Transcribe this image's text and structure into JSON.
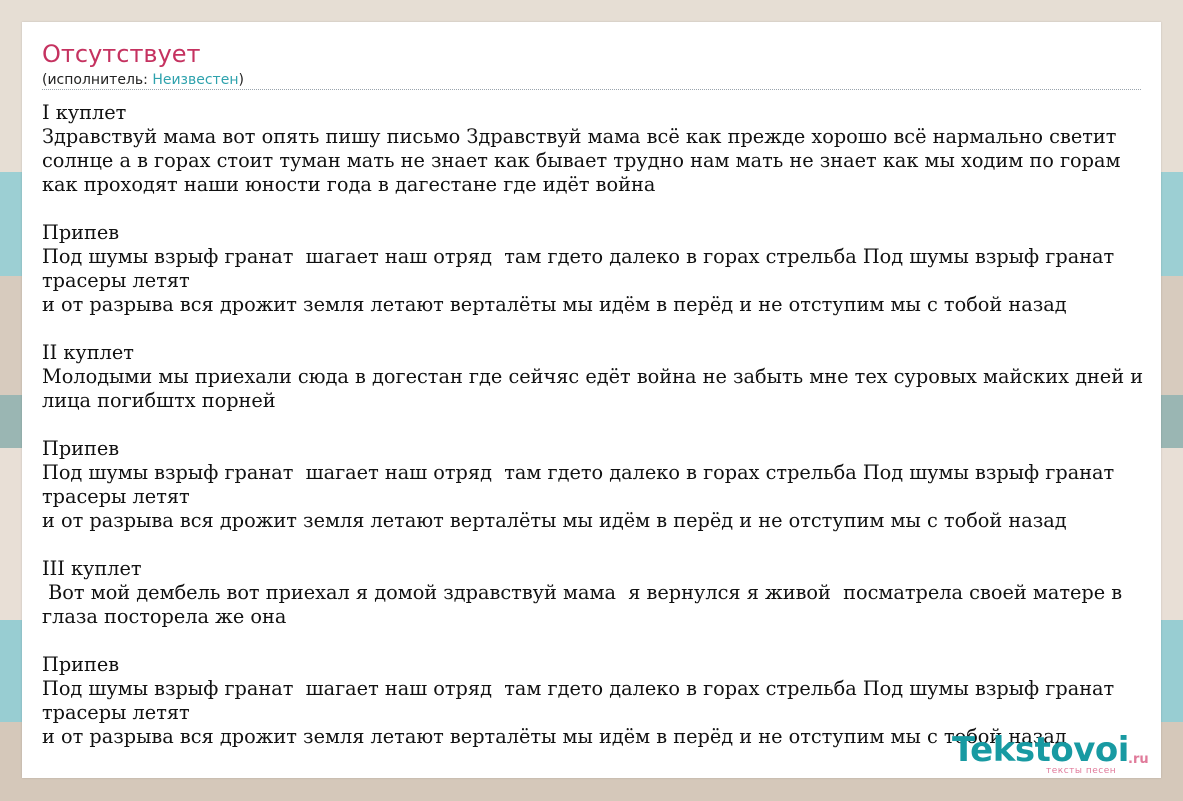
{
  "song": {
    "title": "Отсутствует",
    "artist_prefix": "(исполнитель: ",
    "artist_name": "Неизвестен",
    "artist_suffix": ")"
  },
  "lyrics": [
    "I куплет",
    "Здравствуй мама вот опять пишу письмо Здравствуй мама всё как прежде хорошо всё нармально светит",
    "солнце а в горах стоит туман мать не знает как бывает трудно нам мать не знает как мы ходим по горам",
    "как проходят наши юности года в дагестане где идёт война",
    "",
    "Припев",
    "Под шумы взрыф гранат  шагает наш отряд  там гдето далеко в горах стрельба Под шумы взрыф гранат",
    "трасеры летят",
    "и от разрыва вся дрожит земля летают верталёты мы идём в перёд и не отступим мы с тобой назад",
    "",
    "II куплет",
    "Молодыми мы приехали сюда в догестан где сейчяс едёт война не забыть мне тех суровых майских дней и",
    "лица погибштх порней",
    "",
    "Припев",
    "Под шумы взрыф гранат  шагает наш отряд  там гдето далеко в горах стрельба Под шумы взрыф гранат",
    "трасеры летят",
    "и от разрыва вся дрожит земля летают верталёты мы идём в перёд и не отступим мы с тобой назад",
    "",
    "III куплет",
    " Вот мой дембель вот приехал я домой здравствуй мама  я вернулся я живой  посматрела своей матере в",
    "глаза посторела же она",
    "",
    "Припев",
    "Под шумы взрыф гранат  шагает наш отряд  там гдето далеко в горах стрельба Под шумы взрыф гранат",
    "трасеры летят",
    "и от разрыва вся дрожит земля летают верталёты мы идём в перёд и не отступим мы с тобой назад"
  ],
  "logo": {
    "main": "Tekstovoi",
    "tld": ".ru",
    "sub": "тексты песен"
  },
  "colors": {
    "title": "#c53260",
    "artist_link": "#2ea2ad",
    "logo_main": "#189aa2",
    "logo_accent": "#e07a9a"
  }
}
